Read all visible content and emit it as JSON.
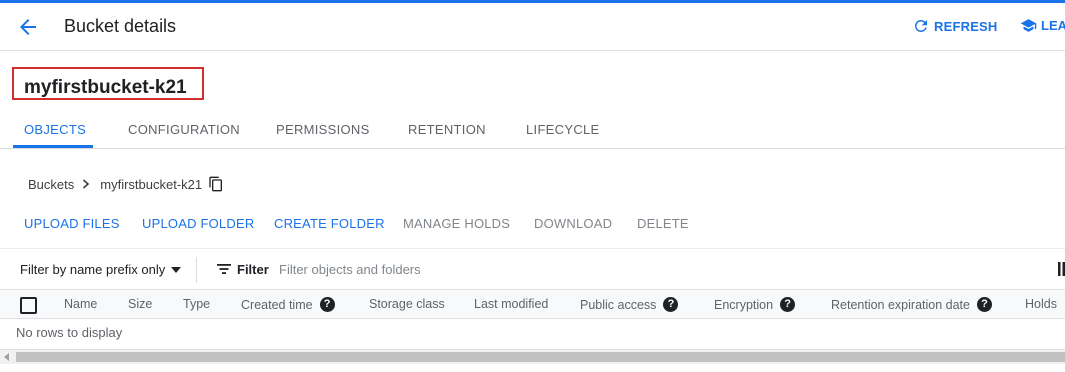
{
  "header": {
    "title": "Bucket details",
    "refresh_label": "REFRESH",
    "learn_label": "LEA",
    "back_icon": "arrow-back-icon"
  },
  "bucket": {
    "name": "myfirstbucket-k21"
  },
  "tabs": [
    {
      "label": "OBJECTS",
      "active": true
    },
    {
      "label": "CONFIGURATION",
      "active": false
    },
    {
      "label": "PERMISSIONS",
      "active": false
    },
    {
      "label": "RETENTION",
      "active": false
    },
    {
      "label": "LIFECYCLE",
      "active": false
    }
  ],
  "breadcrumb": {
    "root": "Buckets",
    "current": "myfirstbucket-k21"
  },
  "actions": [
    {
      "label": "UPLOAD FILES",
      "enabled": true
    },
    {
      "label": "UPLOAD FOLDER",
      "enabled": true
    },
    {
      "label": "CREATE FOLDER",
      "enabled": true
    },
    {
      "label": "MANAGE HOLDS",
      "enabled": false
    },
    {
      "label": "DOWNLOAD",
      "enabled": false
    },
    {
      "label": "DELETE",
      "enabled": false
    }
  ],
  "filter": {
    "mode": "Filter by name prefix only",
    "label": "Filter",
    "placeholder": "Filter objects and folders",
    "value": ""
  },
  "table": {
    "columns": [
      {
        "label": "Name",
        "help": false
      },
      {
        "label": "Size",
        "help": false
      },
      {
        "label": "Type",
        "help": false
      },
      {
        "label": "Created time",
        "help": true
      },
      {
        "label": "Storage class",
        "help": false
      },
      {
        "label": "Last modified",
        "help": false
      },
      {
        "label": "Public access",
        "help": true
      },
      {
        "label": "Encryption",
        "help": true
      },
      {
        "label": "Retention expiration date",
        "help": true
      },
      {
        "label": "Holds",
        "help": false
      }
    ],
    "empty_message": "No rows to display",
    "help_glyph": "?"
  },
  "colors": {
    "accent": "#1a73e8",
    "highlight_box": "#d32f2f",
    "disabled": "#80868b"
  }
}
